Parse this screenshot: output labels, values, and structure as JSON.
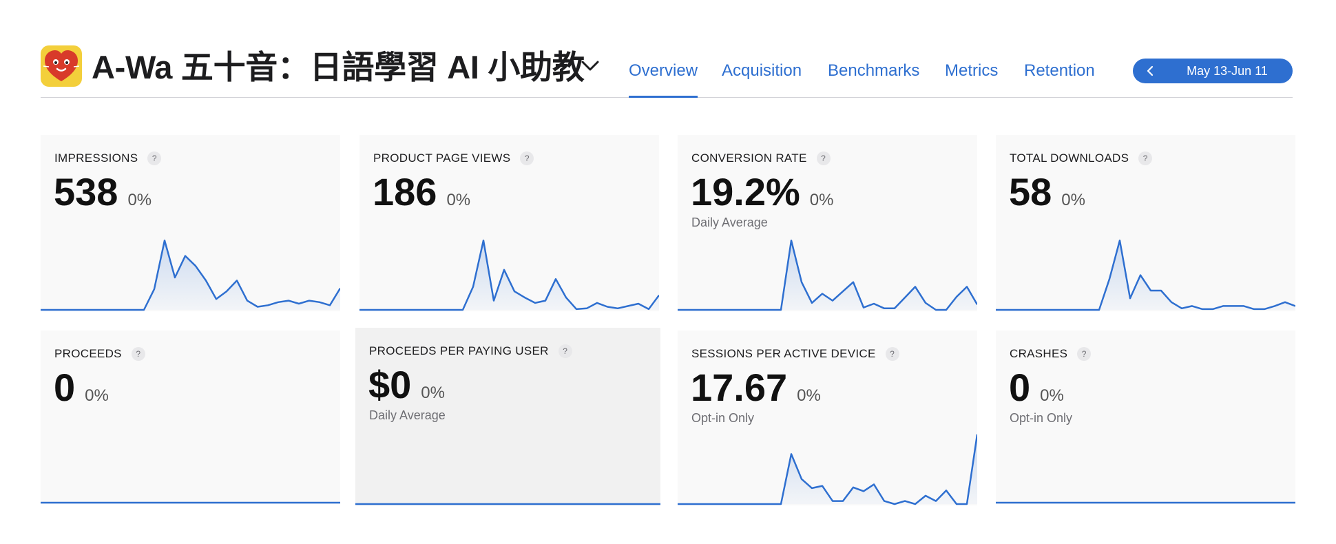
{
  "header": {
    "app_title": "A-Wa 五十音：日語學習 AI 小助教",
    "tabs": [
      {
        "label": "Overview",
        "active": true
      },
      {
        "label": "Acquisition",
        "active": false
      },
      {
        "label": "Benchmarks",
        "active": false
      },
      {
        "label": "Metrics",
        "active": false
      },
      {
        "label": "Retention",
        "active": false
      }
    ],
    "date_range": "May 13-Jun 11",
    "accent_color": "#2e6fd0"
  },
  "icons": {
    "app_icon": "red-heart-face-icon",
    "chevron": "chevron-down-icon",
    "date_prev": "chevron-left-icon",
    "help": "question-mark-icon"
  },
  "help_glyph": "?",
  "cards": [
    {
      "title": "IMPRESSIONS",
      "value": "538",
      "change": "0%",
      "sub": "",
      "points": [
        0,
        0,
        0,
        0,
        0,
        0,
        0,
        0,
        0,
        0,
        0,
        27,
        90,
        42,
        70,
        57,
        38,
        14,
        24,
        38,
        12,
        4,
        6,
        10,
        12,
        8,
        12,
        10,
        6,
        28
      ]
    },
    {
      "title": "PRODUCT PAGE VIEWS",
      "value": "186",
      "change": "0%",
      "sub": "",
      "points": [
        0,
        0,
        0,
        0,
        0,
        0,
        0,
        0,
        0,
        0,
        0,
        30,
        90,
        12,
        52,
        24,
        16,
        9,
        12,
        40,
        16,
        1,
        2,
        9,
        4,
        2,
        5,
        8,
        1,
        19
      ]
    },
    {
      "title": "CONVERSION RATE",
      "value": "19.2%",
      "change": "0%",
      "sub": "Daily Average",
      "points": [
        0,
        0,
        0,
        0,
        0,
        0,
        0,
        0,
        0,
        0,
        0,
        90,
        36,
        9,
        21,
        12,
        24,
        36,
        3,
        8,
        2,
        2,
        16,
        30,
        9,
        0,
        0,
        17,
        30,
        7
      ]
    },
    {
      "title": "TOTAL DOWNLOADS",
      "value": "58",
      "change": "0%",
      "sub": "",
      "points": [
        0,
        0,
        0,
        0,
        0,
        0,
        0,
        0,
        0,
        0,
        0,
        40,
        90,
        15,
        45,
        25,
        25,
        10,
        2,
        5,
        1,
        1,
        5,
        5,
        5,
        1,
        1,
        5,
        10,
        5
      ]
    },
    {
      "title": "PROCEEDS",
      "value": "0",
      "change": "0%",
      "sub": "",
      "points": [
        0,
        0,
        0,
        0,
        0,
        0,
        0,
        0,
        0,
        0,
        0,
        0,
        0,
        0,
        0,
        0,
        0,
        0,
        0,
        0,
        0,
        0,
        0,
        0,
        0,
        0,
        0,
        0,
        0,
        0
      ]
    },
    {
      "title": "PROCEEDS PER PAYING USER",
      "value": "$0",
      "change": "0%",
      "sub": "Daily Average",
      "points": [
        0,
        0,
        0,
        0,
        0,
        0,
        0,
        0,
        0,
        0,
        0,
        0,
        0,
        0,
        0,
        0,
        0,
        0,
        0,
        0,
        0,
        0,
        0,
        0,
        0,
        0,
        0,
        0,
        0,
        0
      ]
    },
    {
      "title": "SESSIONS PER ACTIVE DEVICE",
      "value": "17.67",
      "change": "0%",
      "sub": "Opt-in Only",
      "points": [
        0,
        0,
        0,
        0,
        0,
        0,
        0,
        0,
        0,
        0,
        0,
        66,
        33,
        21,
        24,
        4,
        4,
        22,
        17,
        26,
        4,
        0,
        4,
        0,
        11,
        4,
        18,
        0,
        0,
        92
      ]
    },
    {
      "title": "CRASHES",
      "value": "0",
      "change": "0%",
      "sub": "Opt-in Only",
      "points": [
        0,
        0,
        0,
        0,
        0,
        0,
        0,
        0,
        0,
        0,
        0,
        0,
        0,
        0,
        0,
        0,
        0,
        0,
        0,
        0,
        0,
        0,
        0,
        0,
        0,
        0,
        0,
        0,
        0,
        0
      ]
    }
  ]
}
